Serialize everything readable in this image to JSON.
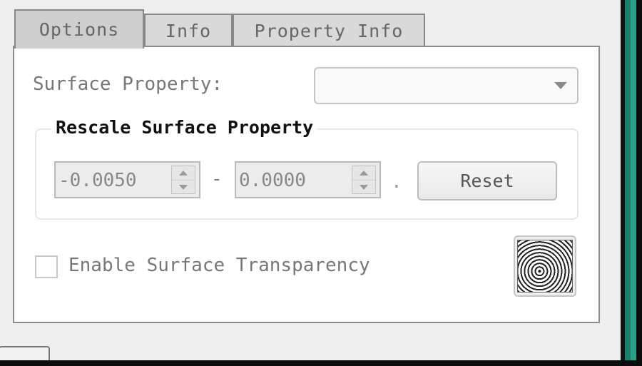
{
  "tabs": [
    {
      "label": "Options",
      "active": true
    },
    {
      "label": "Info",
      "active": false
    },
    {
      "label": "Property Info",
      "active": false
    }
  ],
  "surface_property": {
    "label": "Surface Property:",
    "selected": ""
  },
  "rescale_group": {
    "title": "Rescale Surface Property",
    "min_value": "-0.0050",
    "max_value": "0.0000",
    "separator": "-",
    "trailing": ".",
    "reset_label": "Reset"
  },
  "transparency": {
    "label": "Enable Surface Transparency",
    "checked": false
  },
  "texture_button": {
    "icon": "texture-swatch-icon"
  },
  "colors": {
    "panel_bg": "#ffffff",
    "window_bg": "#eeeeee",
    "accent_strip": "#2aa08a"
  }
}
